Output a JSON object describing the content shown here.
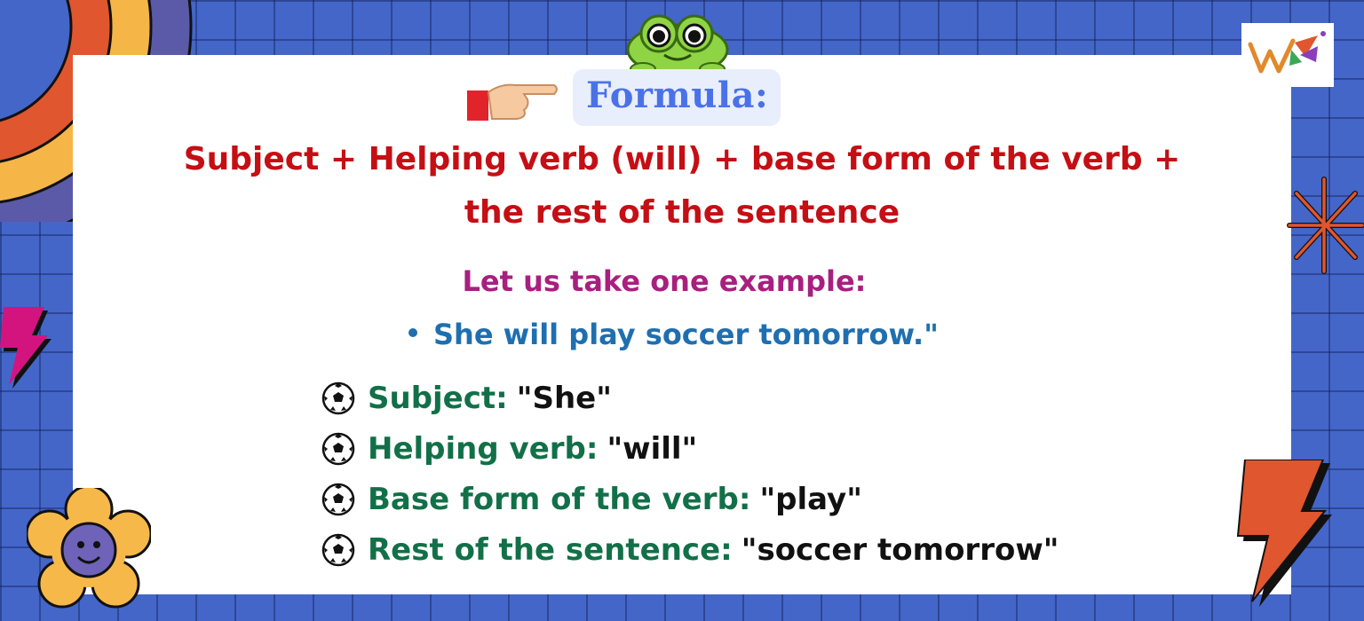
{
  "formula": {
    "label": "Formula:",
    "line1": "Subject + Helping verb (will) + base form of the verb +",
    "line2": "the rest of the sentence"
  },
  "example": {
    "intro": "Let us take one example:",
    "sentence": "She will play soccer tomorrow.\""
  },
  "parts": [
    {
      "label": "Subject:",
      "value": "\"She\""
    },
    {
      "label": "Helping verb:",
      "value": "\"will\""
    },
    {
      "label": "Base form of the verb:",
      "value": "\"play\""
    },
    {
      "label": "Rest of the sentence:",
      "value": "\"soccer tomorrow\""
    }
  ],
  "icons": {
    "pointer": "pointing-hand-icon",
    "mascot": "frog-icon",
    "bullet": "soccer-ball-icon",
    "flower": "flower-face-icon",
    "logo": "brand-logo-icon"
  },
  "colors": {
    "background": "#4466c8",
    "formula_text": "#c40f14",
    "formula_label": "#4a72e8",
    "intro": "#a8207f",
    "sentence": "#1f6fb0",
    "part_label": "#127048"
  }
}
